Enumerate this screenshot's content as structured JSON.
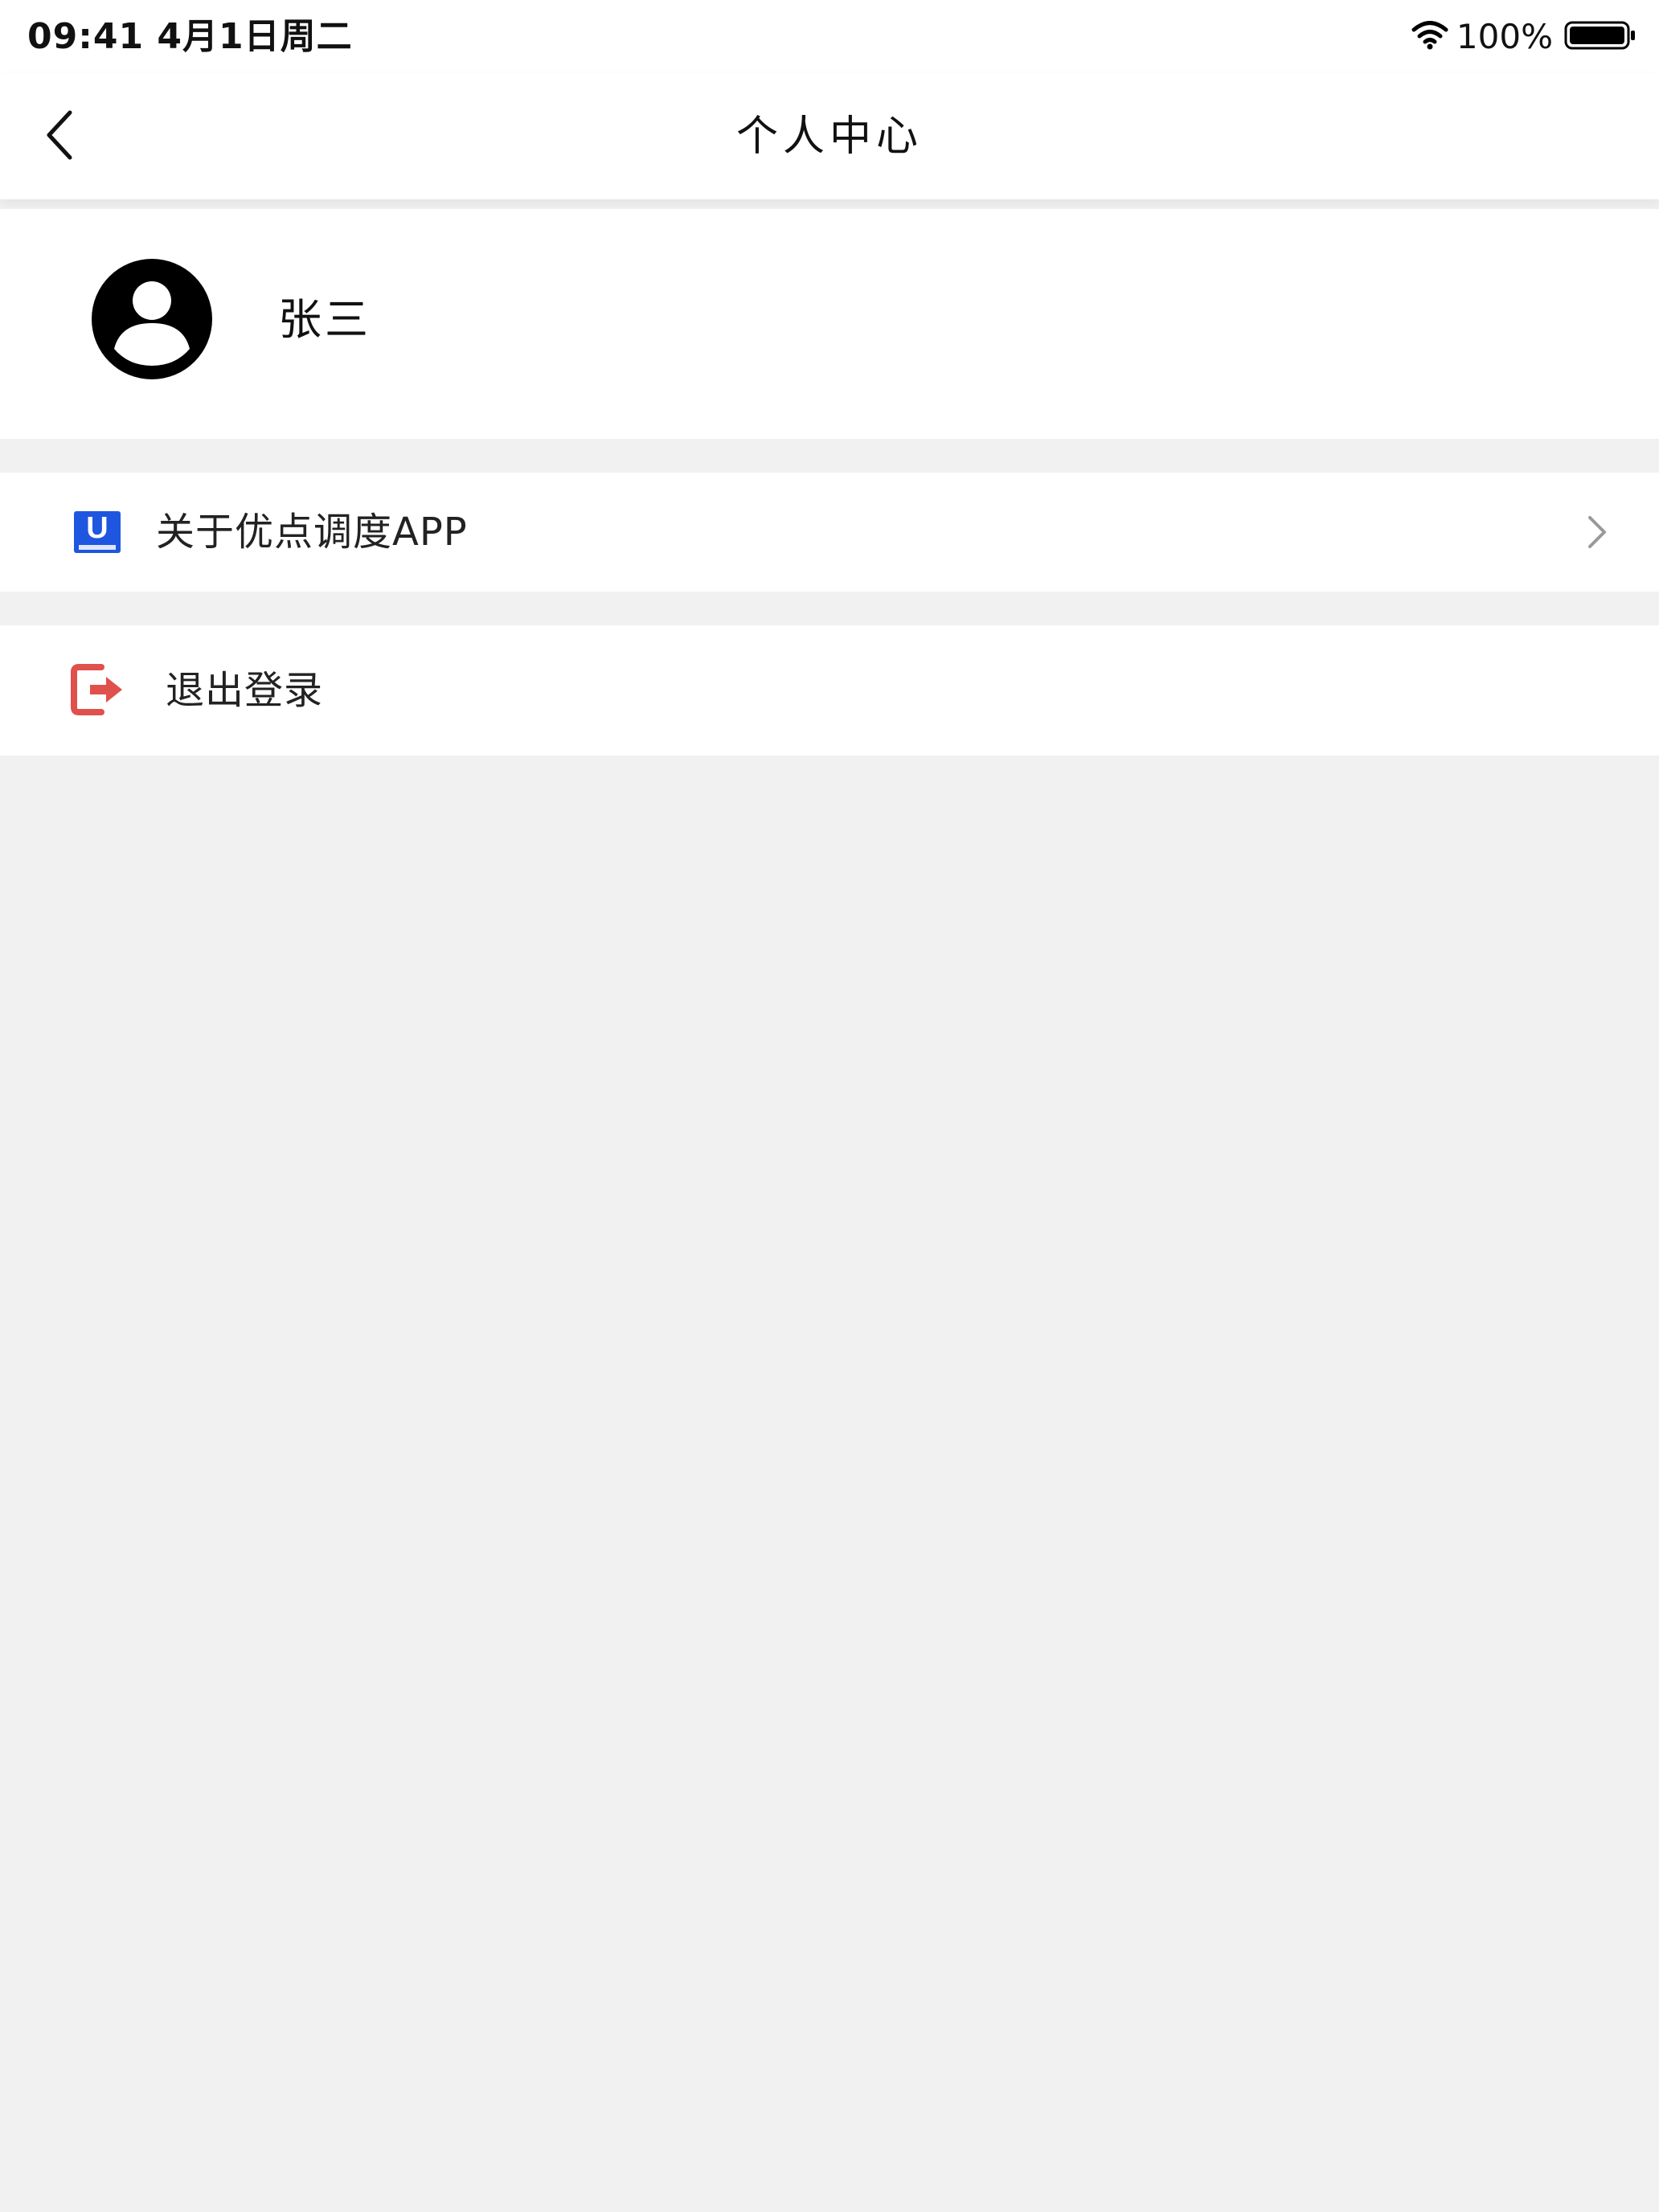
{
  "status_bar": {
    "time": "09:41  4月1日周二",
    "battery_percent": "100%",
    "wifi_icon": "wifi-icon",
    "battery_icon": "battery-icon"
  },
  "header": {
    "title": "个人中心",
    "back_icon": "chevron-left-icon"
  },
  "profile": {
    "name": "张三",
    "avatar_icon": "user-avatar-icon"
  },
  "menu": {
    "about": {
      "label": "关于优点调度APP",
      "icon": "app-logo-icon",
      "logo_letter": "U",
      "logo_color": "#1e56e0",
      "chevron_icon": "chevron-right-icon"
    },
    "logout": {
      "label": "退出登录",
      "icon": "logout-icon",
      "icon_color": "#e0504c"
    }
  },
  "colors": {
    "page_background": "#f1f1f1",
    "card_background": "#ffffff",
    "text_primary": "#111111"
  }
}
